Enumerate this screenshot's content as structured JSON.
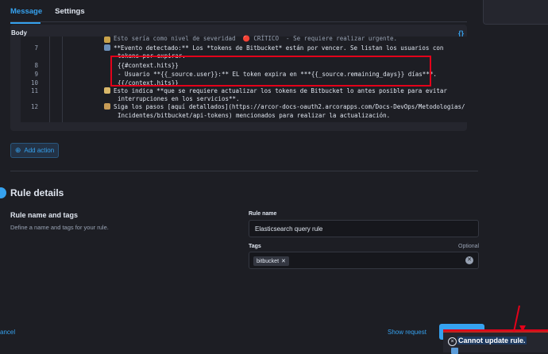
{
  "tabs": [
    "Message",
    "Settings"
  ],
  "body": {
    "label": "Body",
    "icon": "brackets-icon",
    "lines": [
      {
        "num": "",
        "text": "Esto sería como nivel de severidad  🔴 CRÍTICO  - Se requiere realizar urgente."
      },
      {
        "num": "7",
        "text": "**Evento detectado:** Los *tokens de Bitbucket* están por vencer. Se listan los usuarios con"
      },
      {
        "num": "",
        "text": "tokens por expirar."
      },
      {
        "num": "8",
        "text": "{{#context.hits}}"
      },
      {
        "num": "9",
        "text": "- Usuario **{{_source.user}}:** EL token expira en ***{{_source.remaining_days}} días***."
      },
      {
        "num": "10",
        "text": "{{/context.hits}}"
      },
      {
        "num": "11",
        "text": "Esto indica **que se requiere actualizar los tokens de Bitbucket lo antes posible para evitar"
      },
      {
        "num": "",
        "text": "interrupciones en los servicios**."
      },
      {
        "num": "12",
        "text": "Siga los pasos [aquí detallados](https://arcor-docs-oauth2.arcorapps.com/Docs-DevOps/Metodologias/"
      },
      {
        "num": "",
        "text": "Incidentes/bitbucket/api-tokens) mencionados para realizar la actualización."
      }
    ]
  },
  "add_action_label": "Add action",
  "rule_details": {
    "title": "Rule details",
    "section_title": "Rule name and tags",
    "section_desc": "Define a name and tags for your rule.",
    "name_label": "Rule name",
    "name_value": "Elasticsearch query rule",
    "tags_label": "Tags",
    "tags_optional": "Optional",
    "tags": [
      "bitbucket"
    ]
  },
  "footer": {
    "cancel": "ancel",
    "show_request": "Show request"
  },
  "toast": {
    "title": "Cannot update rule."
  },
  "colors": {
    "accent": "#36a2ef",
    "annotation": "#e3021a",
    "danger": "#bd271e"
  }
}
